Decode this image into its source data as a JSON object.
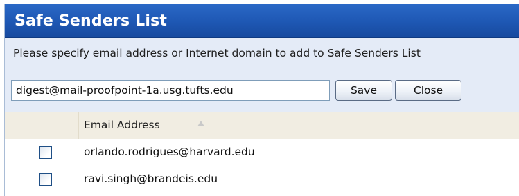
{
  "dialog": {
    "title": "Safe Senders List",
    "instruction": "Please specify email address or Internet domain to add to Safe Senders List"
  },
  "form": {
    "email_value": "digest@mail-proofpoint-1a.usg.tufts.edu",
    "save_label": "Save",
    "close_label": "Close"
  },
  "grid": {
    "column_header": "Email Address",
    "sort_icon": "sort-ascending-icon",
    "rows": [
      {
        "email": "orlando.rodrigues@harvard.edu",
        "checked": false
      },
      {
        "email": "ravi.singh@brandeis.edu",
        "checked": false
      }
    ]
  },
  "colors": {
    "title_bar": "#1e57b3",
    "form_background": "#e4ebf7",
    "header_background": "#f1ede2"
  }
}
